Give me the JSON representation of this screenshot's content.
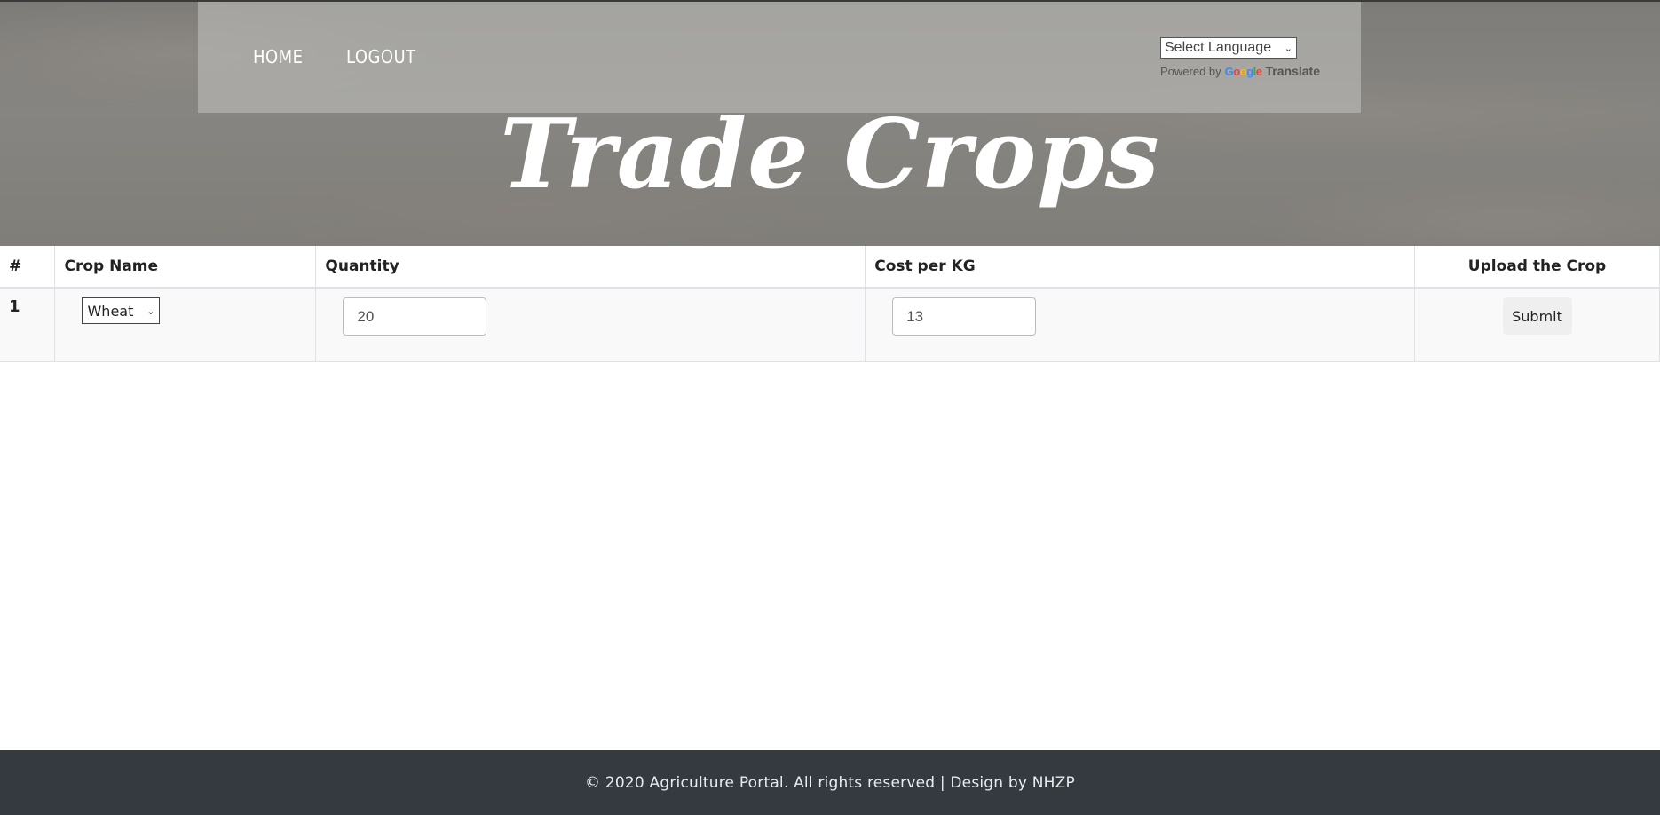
{
  "nav": {
    "home": "HOME",
    "logout": "LOGOUT"
  },
  "translate": {
    "select_value": "Select Language",
    "powered_by": "Powered by",
    "google": "Google",
    "translate_label": "Translate"
  },
  "hero": {
    "title": "Trade Crops"
  },
  "table": {
    "headers": [
      "#",
      "Crop Name",
      "Quantity",
      "Cost per KG",
      "Upload the Crop"
    ],
    "rows": [
      {
        "index": "1",
        "crop": "Wheat",
        "quantity": "20",
        "cost": "13",
        "action": "Submit"
      }
    ]
  },
  "footer": {
    "text": "© 2020 Agriculture Portal. All rights reserved | Design by NHZP"
  }
}
